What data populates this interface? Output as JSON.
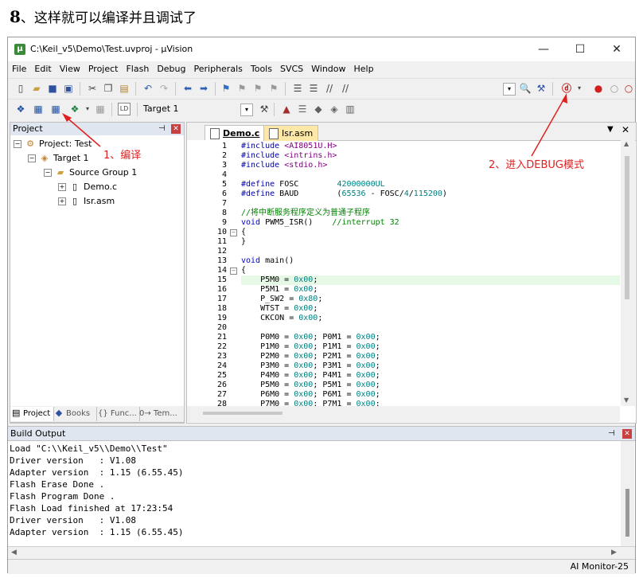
{
  "heading": {
    "number": "8",
    "text": "、这样就可以编译并且调试了"
  },
  "window": {
    "title": "C:\\Keil_v5\\Demo\\Test.uvproj - µVision",
    "app_icon": "uvision-icon"
  },
  "menu": [
    "File",
    "Edit",
    "View",
    "Project",
    "Flash",
    "Debug",
    "Peripherals",
    "Tools",
    "SVCS",
    "Window",
    "Help"
  ],
  "toolbar2": {
    "target": "Target 1"
  },
  "project": {
    "header": "Project",
    "root": "Project: Test",
    "target": "Target 1",
    "group": "Source Group 1",
    "files": [
      "Demo.c",
      "Isr.asm"
    ],
    "tabs": [
      "Project",
      "Books",
      "{} Func...",
      "0→ Tem..."
    ]
  },
  "editor": {
    "tabs": [
      "Demo.c",
      "Isr.asm"
    ],
    "lines": [
      "#include <AI8051U.H>",
      "#include <intrins.h>",
      "#include <stdio.h>",
      "",
      "#define FOSC        42000000UL",
      "#define BAUD        (65536 - FOSC/4/115200)",
      "",
      "//将中断服务程序定义为普通子程序",
      "void PWM5_ISR()    //interrupt 32",
      "{",
      "}",
      "",
      "void main()",
      "{",
      "    P5M0 = 0x00;",
      "    P5M1 = 0x00;",
      "    P_SW2 = 0x80;",
      "    WTST = 0x00;",
      "    CKCON = 0x00;",
      "",
      "    P0M0 = 0x00; P0M1 = 0x00;",
      "    P1M0 = 0x00; P1M1 = 0x00;",
      "    P2M0 = 0x00; P2M1 = 0x00;",
      "    P3M0 = 0x00; P3M1 = 0x00;",
      "    P4M0 = 0x00; P4M1 = 0x00;",
      "    P5M0 = 0x00; P5M1 = 0x00;",
      "    P6M0 = 0x00; P6M1 = 0x00;",
      "    P7M0 = 0x00; P7M1 = 0x00;"
    ],
    "highlight_line": 15
  },
  "build": {
    "header": "Build Output",
    "lines": [
      "Load \"C:\\\\Keil_v5\\\\Demo\\\\Test\"",
      "Driver version   : V1.08",
      "Adapter version  : 1.15 (6.55.45)",
      "Flash Erase Done .",
      "Flash Program Done .",
      "Flash Load finished at 17:23:54",
      "Driver version   : V1.08",
      "Adapter version  : 1.15 (6.55.45)"
    ]
  },
  "status": "AI Monitor-25",
  "annotations": {
    "compile": "1、编译",
    "debug": "2、进入DEBUG模式",
    "color": "#e02020"
  }
}
